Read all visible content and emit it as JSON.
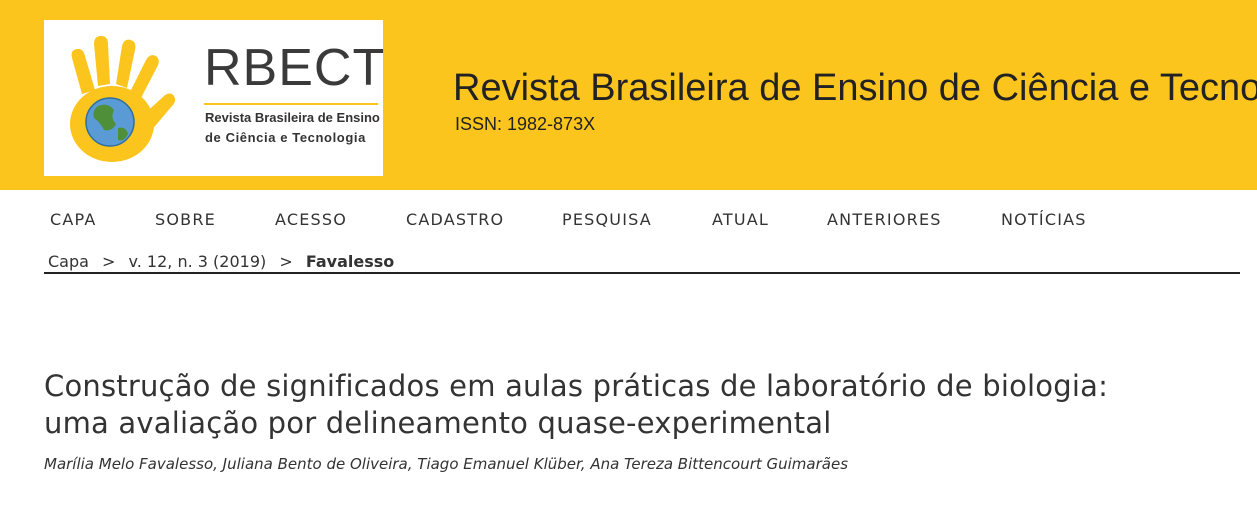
{
  "header": {
    "logo": {
      "acronym": "RBECT",
      "subtitle_line1": "Revista Brasileira de Ensino",
      "subtitle_line2": "de Ciência e Tecnologia"
    },
    "journal_title": "Revista Brasileira de Ensino de Ciência e Tecnologia",
    "issn": "ISSN: 1982-873X",
    "brand_color": "#FCC51D"
  },
  "nav": {
    "items": [
      {
        "label": "CAPA"
      },
      {
        "label": "SOBRE"
      },
      {
        "label": "ACESSO"
      },
      {
        "label": "CADASTRO"
      },
      {
        "label": "PESQUISA"
      },
      {
        "label": "ATUAL"
      },
      {
        "label": "ANTERIORES"
      },
      {
        "label": "NOTÍCIAS"
      }
    ]
  },
  "breadcrumb": {
    "home": "Capa",
    "separator": ">",
    "issue": "v. 12, n. 3 (2019)",
    "current": "Favalesso"
  },
  "article": {
    "title_line1": "Construção de significados em aulas práticas de laboratório de biologia:",
    "title_line2": "uma avaliação por delineamento quase-experimental",
    "authors": "Marília Melo Favalesso, Juliana Bento de Oliveira, Tiago Emanuel Klüber, Ana Tereza Bittencourt Guimarães"
  }
}
